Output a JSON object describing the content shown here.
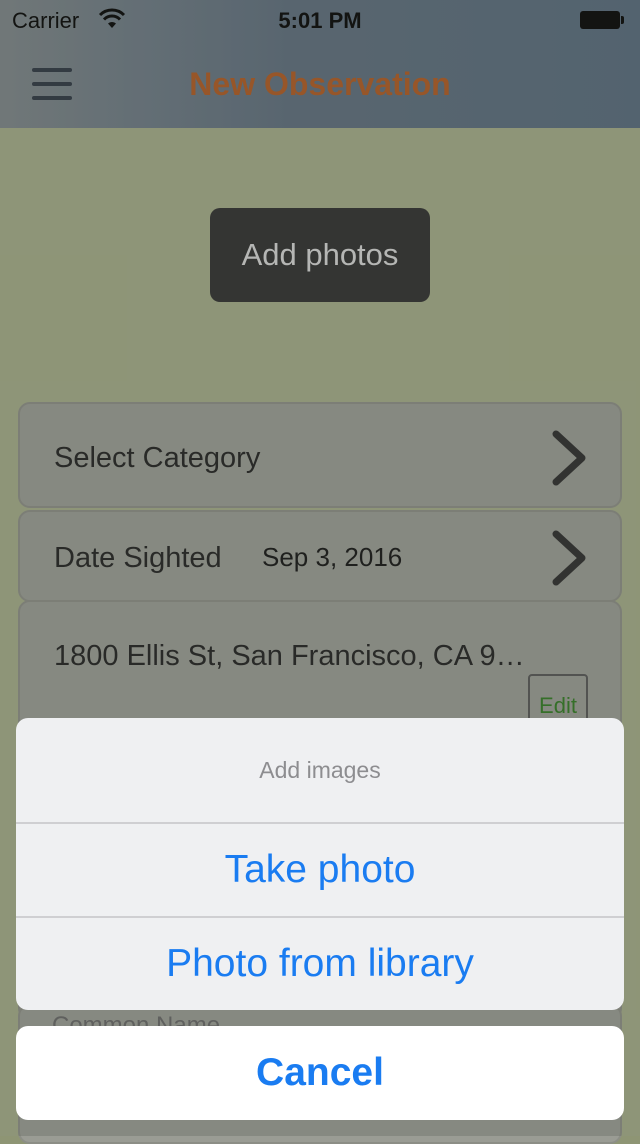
{
  "status_bar": {
    "carrier": "Carrier",
    "time": "5:01 PM"
  },
  "nav": {
    "title": "New Observation"
  },
  "add_photos": {
    "label": "Add photos"
  },
  "form": {
    "category": {
      "label": "Select Category"
    },
    "date": {
      "label": "Date Sighted",
      "value": "Sep 3, 2016"
    },
    "location": {
      "address": "1800 Ellis St, San Francisco, CA 9…",
      "edit_label": "Edit"
    },
    "common_name": {
      "label": "Common Name"
    }
  },
  "action_sheet": {
    "title": "Add images",
    "actions": [
      "Take photo",
      "Photo from library"
    ],
    "cancel": "Cancel"
  },
  "colors": {
    "nav_title": "#b0591f",
    "action_blue": "#1a7cf1",
    "edit_green": "#2e7a1f",
    "background": "#a5ac88"
  }
}
